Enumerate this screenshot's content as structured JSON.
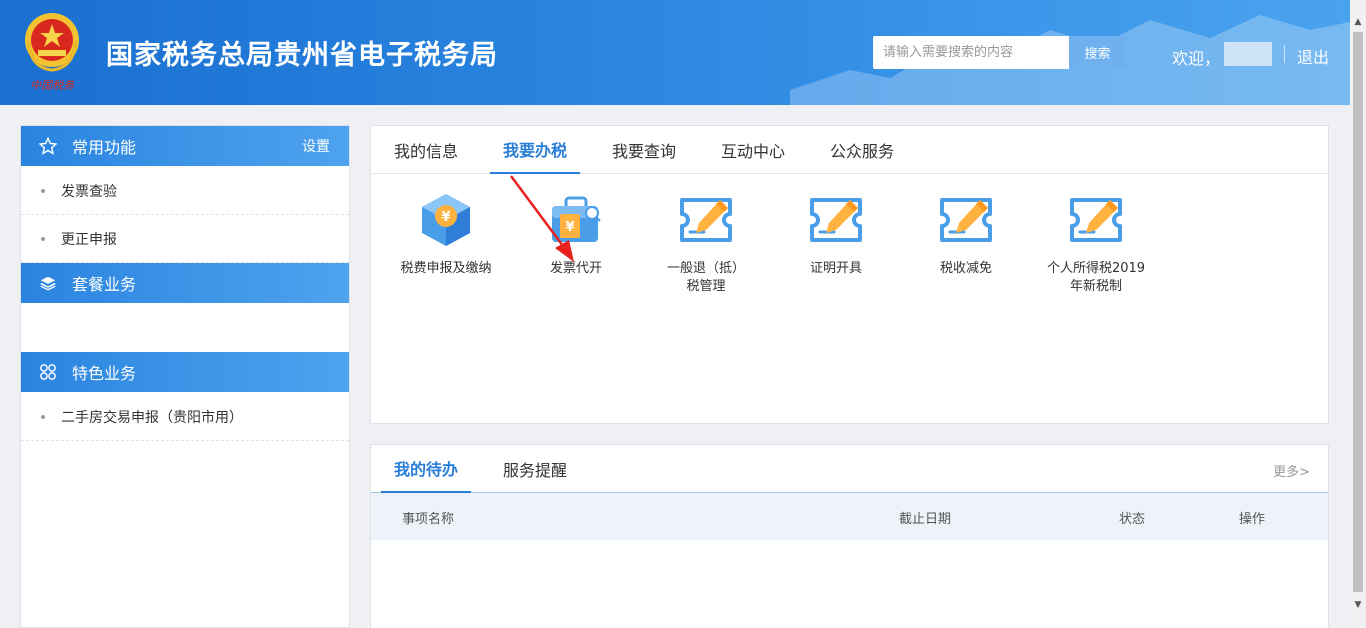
{
  "header": {
    "title": "国家税务总局贵州省电子税务局",
    "search_placeholder": "请输入需要搜索的内容",
    "search_button": "搜索",
    "welcome": "欢迎，",
    "logout": "退出",
    "emblem_text": "中国税务"
  },
  "sidebar": {
    "sections": [
      {
        "title": "常用功能",
        "action": "设置",
        "icon": "star-icon",
        "items": [
          "发票查验",
          "更正申报"
        ]
      },
      {
        "title": "套餐业务",
        "icon": "layers-icon",
        "items": []
      },
      {
        "title": "特色业务",
        "icon": "grid-icon",
        "items": [
          "二手房交易申报（贵阳市用）"
        ]
      }
    ]
  },
  "main": {
    "tabs": [
      "我的信息",
      "我要办税",
      "我要查询",
      "互动中心",
      "公众服务"
    ],
    "active_tab": "我要办税",
    "functions": [
      {
        "label": "税费申报及缴纳",
        "icon": "tax-box-icon"
      },
      {
        "label": "发票代开",
        "icon": "invoice-bag-icon"
      },
      {
        "label": "一般退（抵）税管理",
        "icon": "edit-ticket-icon"
      },
      {
        "label": "证明开具",
        "icon": "edit-ticket-icon"
      },
      {
        "label": "税收减免",
        "icon": "edit-ticket-icon"
      },
      {
        "label": "个人所得税2019年新税制",
        "icon": "edit-ticket-icon"
      }
    ]
  },
  "todo": {
    "tabs": [
      "我的待办",
      "服务提醒"
    ],
    "active_tab": "我的待办",
    "more": "更多>",
    "columns": [
      "事项名称",
      "截止日期",
      "状态",
      "操作"
    ],
    "rows": []
  },
  "colors": {
    "primary": "#2a7ed8",
    "header_gradient_start": "#1a6fd0",
    "annotation_arrow": "#e8201e"
  }
}
